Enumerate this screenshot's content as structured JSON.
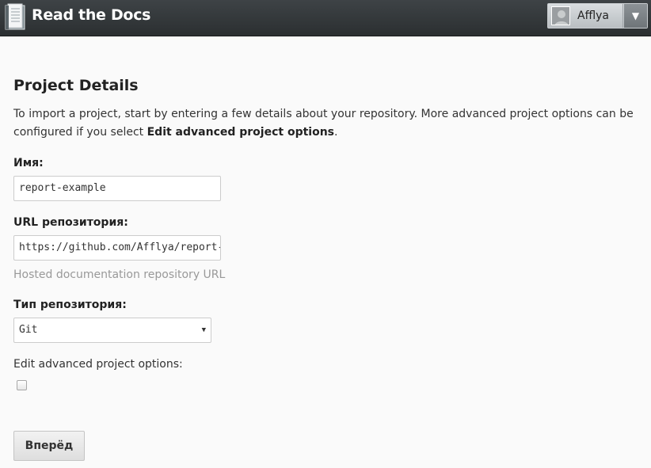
{
  "header": {
    "brand": "Read the Docs",
    "username": "Afflya",
    "caret": "▼"
  },
  "page": {
    "title": "Project Details",
    "intro_before": "To import a project, start by entering a few details about your repository. More advanced project options can be configured if you select ",
    "intro_bold": "Edit advanced project options",
    "intro_after": "."
  },
  "form": {
    "name": {
      "label": "Имя:",
      "value": "report-example"
    },
    "repo_url": {
      "label": "URL репозитория:",
      "value": "https://github.com/Afflya/report-example",
      "help": "Hosted documentation repository URL"
    },
    "repo_type": {
      "label": "Тип репозитория:",
      "selected": "Git"
    },
    "advanced": {
      "label": "Edit advanced project options:",
      "checked": false
    },
    "submit_label": "Вперёд"
  }
}
